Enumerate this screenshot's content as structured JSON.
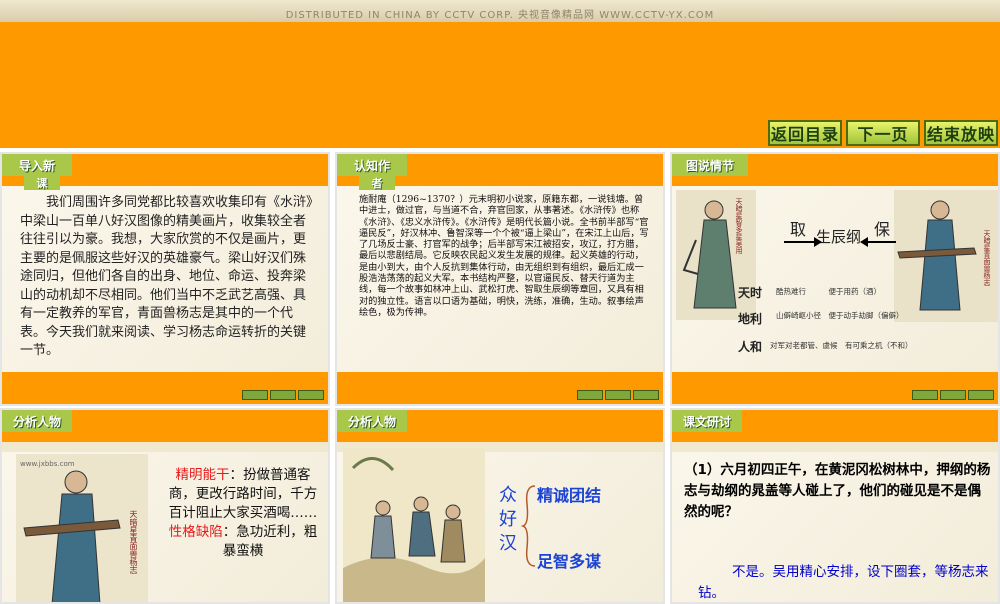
{
  "header": {
    "credit": "DISTRIBUTED IN CHINA BY CCTV CORP. 央视音像精品网 WWW.CCTV-YX.COM"
  },
  "nav": {
    "back": "返回目录",
    "next": "下一页",
    "end": "结束放映"
  },
  "slide1": {
    "tag_line1": "导入新",
    "tag_line2": "课",
    "body": "我们周围许多同党都比较喜欢收集印有《水浒》中梁山一百单八好汉图像的精美画片，收集较全者往往引以为豪。我想，大家欣赏的不仅是画片，更主要的是佩服这些好汉的英雄豪气。梁山好汉们殊途同归，但他们各自的出身、地位、命运、投奔梁山的动机却不尽相同。他们当中不乏武艺高强、具有一定教养的军官，青面兽杨志是其中的一个代表。今天我们就来阅读、学习杨志命运转折的关键一节。"
  },
  "slide2": {
    "tag_line1": "认知作",
    "tag_line2": "者",
    "body": "施耐庵（1296~1370？）元末明初小说家，原籍东都，一说钱塘。曾中进士，做过官，与当道不合，弃官回家，从事著述。《水浒传》也称《水浒》、《忠义水浒传》。《水浒传》是明代长篇小说。全书前半部写“官逼民反”，好汉林冲、鲁智深等一个个被“逼上梁山”，在宋江上山后，写了几场反士豪、打官军的战争；后半部写宋江被招安，攻辽，打方腊，最后以悲剧结局。它反映农民起义发生发展的规律。起义英雄的行动，是由小到大，由个人反抗到集体行动，由无组织到有组织，最后汇成一股浩浩荡荡的起义大军。本书结构严整，以官逼民反、替天行道为主线，每一个故事如林冲上山、武松打虎、智取生辰纲等章回，又具有相对的独立性。语言以口语为基础，明快，洗练，准确，生动。叙事绘声绘色，极为传神。"
  },
  "slide3": {
    "tag": "图说情节",
    "seal_left": "天暗星智多星吴用",
    "seal_right": "天暗星青面兽杨志",
    "take": "取",
    "object": "生辰纲",
    "protect": "保",
    "tian": "天时",
    "tian_desc": "酷热难行　　　便于用药（酒）",
    "di": "地利",
    "di_desc": "山僻崎岖小径　便于动手劫脚（偏僻）",
    "ren": "人和",
    "ren_desc": "对军对老都管、虞候　有可乘之机（不和）"
  },
  "slide4": {
    "tag": "分析人物",
    "watermark": "www.jxbbs.com",
    "seal": "天暗星青面兽杨志",
    "strength_label": "精明能干",
    "strength_text": "：扮做普通客商，更改行路时间，千方百计阻止大家买酒喝……",
    "weakness_label": "性格缺陷",
    "weakness_text": "：急功近利，粗暴蛮横"
  },
  "slide5": {
    "tag": "分析人物",
    "subject": "众好汉",
    "trait1": "精诚团结",
    "trait2": "足智多谋"
  },
  "slide6": {
    "tag": "课文研讨",
    "question": "（1）六月初四正午，在黄泥冈松树林中，押纲的杨志与劫纲的晁盖等人碰上了，他们的碰见是不是偶然的呢？",
    "answer": "不是。吴用精心安排，设下圈套，等杨志来钻。"
  },
  "colors": {
    "orange": "#ff9900",
    "accent_red": "#e8191b",
    "answer_blue": "#0000cc",
    "trait_blue": "#1b43d6"
  }
}
